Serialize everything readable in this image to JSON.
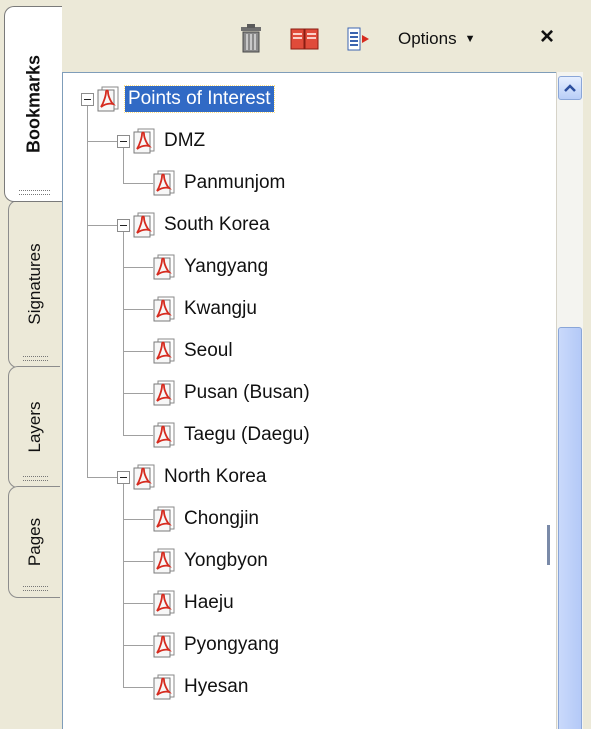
{
  "tabs": [
    {
      "label": "Bookmarks",
      "active": true
    },
    {
      "label": "Signatures",
      "active": false
    },
    {
      "label": "Layers",
      "active": false
    },
    {
      "label": "Pages",
      "active": false
    }
  ],
  "toolbar": {
    "delete_icon": "trash-icon",
    "new_bookmark_icon": "new-bookmark-icon",
    "expand_bookmark_icon": "expand-bookmark-icon",
    "options_label": "Options",
    "close_label": "×"
  },
  "tree": {
    "root": {
      "label": "Points of Interest",
      "selected": true,
      "expanded": true
    },
    "groups": [
      {
        "label": "DMZ",
        "expanded": true,
        "children": [
          "Panmunjom"
        ]
      },
      {
        "label": "South Korea",
        "expanded": true,
        "children": [
          "Yangyang",
          "Kwangju",
          "Seoul",
          "Pusan (Busan)",
          "Taegu (Daegu)"
        ]
      },
      {
        "label": "North Korea",
        "expanded": true,
        "children": [
          "Chongjin",
          "Yongbyon",
          "Haeju",
          "Pyongyang",
          "Hyesan"
        ]
      }
    ]
  },
  "colors": {
    "selection": "#316ac5",
    "panel": "#ece9d8",
    "pdf_icon_red": "#d62b1f"
  }
}
